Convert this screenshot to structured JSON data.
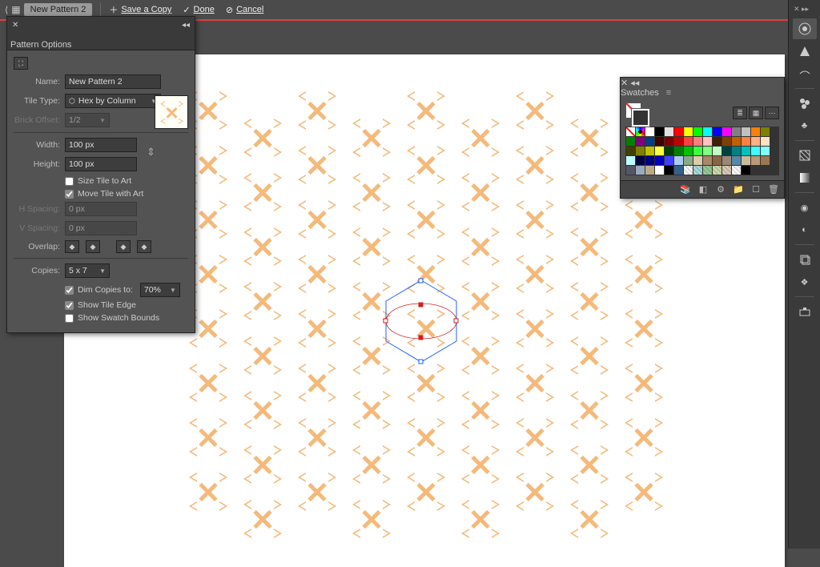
{
  "topbar": {
    "doc_title": "New Pattern 2",
    "save_label": "Save a Copy",
    "done_label": "Done",
    "cancel_label": "Cancel"
  },
  "pattern_panel": {
    "title": "Pattern Options",
    "name_label": "Name:",
    "name_value": "New Pattern 2",
    "tiletype_label": "Tile Type:",
    "tiletype_value": "Hex by Column",
    "brickoffset_label": "Brick Offset:",
    "brickoffset_value": "1/2",
    "width_label": "Width:",
    "width_value": "100 px",
    "height_label": "Height:",
    "height_value": "100 px",
    "size_to_art_label": "Size Tile to Art",
    "move_with_art_label": "Move Tile with Art",
    "hspacing_label": "H Spacing:",
    "hspacing_value": "0 px",
    "vspacing_label": "V Spacing:",
    "vspacing_value": "0 px",
    "overlap_label": "Overlap:",
    "copies_label": "Copies:",
    "copies_value": "5 x 7",
    "dim_copies_label": "Dim Copies to:",
    "dim_copies_value": "70%",
    "show_tile_edge_label": "Show Tile Edge",
    "show_swatch_bounds_label": "Show Swatch Bounds"
  },
  "swatches": {
    "title": "Swatches",
    "colors": [
      "#ffffff",
      "#000000",
      "#e0e0e0",
      "#ff0000",
      "#ffff00",
      "#00ff00",
      "#00ffff",
      "#0000ff",
      "#ff00ff",
      "#808080",
      "#c0c0c0",
      "#ff8000",
      "#808000",
      "#008000",
      "#800080",
      "#004080",
      "#400000",
      "#800000",
      "#c00000",
      "#ff4040",
      "#ff8080",
      "#ffc0c0",
      "#402000",
      "#804000",
      "#c06000",
      "#ff8040",
      "#ffb080",
      "#ffe0c0",
      "#404000",
      "#808000",
      "#c0c000",
      "#ffff40",
      "#004000",
      "#008000",
      "#00c000",
      "#40ff40",
      "#80ff80",
      "#c0ffc0",
      "#004040",
      "#008080",
      "#00c0c0",
      "#40ffff",
      "#80ffff",
      "#c0ffff",
      "#000040",
      "#000080",
      "#0000c0",
      "#4040ff",
      "#aaccee",
      "#88aa88",
      "#ddccaa",
      "#aa8866",
      "#886644",
      "#998877",
      "#5588aa",
      "#ccbb99",
      "#bb9977",
      "#997755",
      "#555566",
      "#99aabb",
      "#bbaa88",
      "#ffffff",
      "#000000",
      "#325f8c"
    ]
  },
  "dock": {
    "icons": [
      "color-icon",
      "gradient-icon",
      "stroke-icon",
      "brushes-icon",
      "symbols-icon",
      "transparency-icon",
      "appearance-icon",
      "graphic-styles-icon",
      "layers-icon",
      "artboards-icon",
      "links-icon",
      "align-icon",
      "pathfinder-icon"
    ]
  },
  "pattern": {
    "accent": "#f5b97a"
  }
}
